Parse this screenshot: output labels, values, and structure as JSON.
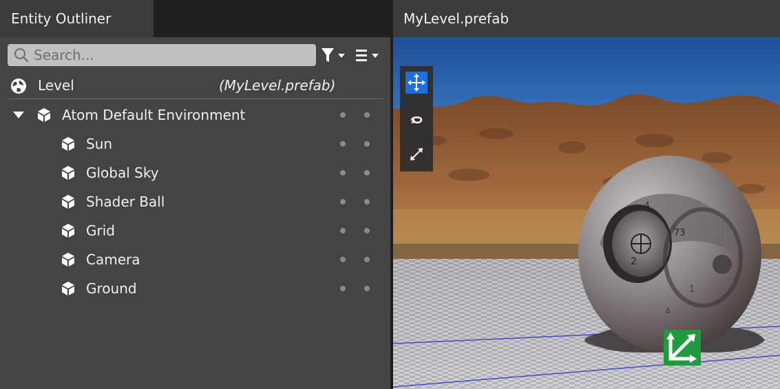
{
  "outliner": {
    "tab_title": "Entity Outliner",
    "search_placeholder": "Search...",
    "level": {
      "label": "Level",
      "file": "(MyLevel.prefab)"
    },
    "entities": [
      {
        "label": "Atom Default Environment",
        "expanded": true,
        "depth": 0
      },
      {
        "label": "Sun",
        "depth": 1
      },
      {
        "label": "Global Sky",
        "depth": 1
      },
      {
        "label": "Shader Ball",
        "depth": 1
      },
      {
        "label": "Grid",
        "depth": 1
      },
      {
        "label": "Camera",
        "depth": 1
      },
      {
        "label": "Ground",
        "depth": 1
      }
    ]
  },
  "viewport": {
    "tab_title": "MyLevel.prefab",
    "tools": [
      {
        "name": "move-icon",
        "active": true
      },
      {
        "name": "rotate-icon",
        "active": false
      },
      {
        "name": "scale-icon",
        "active": false
      }
    ],
    "shader_ball_numbers": [
      "4",
      "73",
      "2",
      "1",
      "4"
    ]
  },
  "colors": {
    "active_tool": "#1e6fe0",
    "manipulator": "#1f9a3c",
    "sky": "#2a5aa6",
    "panel": "#444444"
  }
}
